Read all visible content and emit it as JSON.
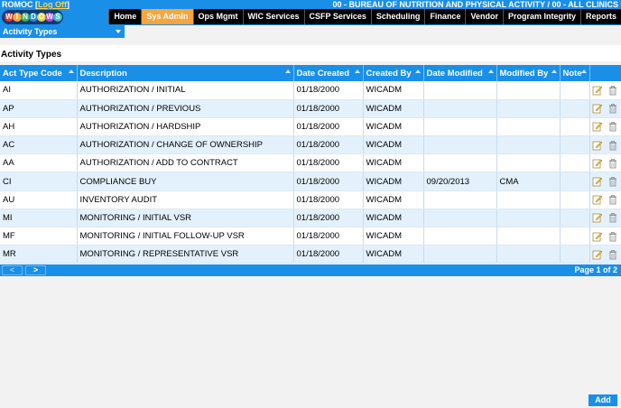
{
  "header": {
    "user": "ROMOC",
    "logoff_label": "Log Off",
    "agency": "00 - BUREAU OF NUTRITION AND PHYSICAL ACTIVITY / 00 - ALL CLINICS",
    "logo_letters": [
      "W",
      "I",
      "N",
      "D",
      "O",
      "W",
      "S"
    ]
  },
  "nav": {
    "items": [
      "Home",
      "Sys Admin",
      "Ops Mgmt",
      "WIC Services",
      "CSFP Services",
      "Scheduling",
      "Finance",
      "Vendor",
      "Program Integrity",
      "Reports"
    ],
    "active": "Sys Admin",
    "accent_color": "#f7a53c"
  },
  "module_select": {
    "value": "Activity Types"
  },
  "page_title": "Activity Types",
  "table": {
    "columns": [
      "Act Type Code",
      "Description",
      "Date Created",
      "Created By",
      "Date Modified",
      "Modified By",
      "Note"
    ],
    "rows": [
      [
        "AI",
        "AUTHORIZATION / INITIAL",
        "01/18/2000",
        "WICADM",
        "",
        "",
        ""
      ],
      [
        "AP",
        "AUTHORIZATION / PREVIOUS",
        "01/18/2000",
        "WICADM",
        "",
        "",
        ""
      ],
      [
        "AH",
        "AUTHORIZATION / HARDSHIP",
        "01/18/2000",
        "WICADM",
        "",
        "",
        ""
      ],
      [
        "AC",
        "AUTHORIZATION / CHANGE OF OWNERSHIP",
        "01/18/2000",
        "WICADM",
        "",
        "",
        ""
      ],
      [
        "AA",
        "AUTHORIZATION / ADD TO CONTRACT",
        "01/18/2000",
        "WICADM",
        "",
        "",
        ""
      ],
      [
        "CI",
        "COMPLIANCE BUY",
        "01/18/2000",
        "WICADM",
        "09/20/2013",
        "CMA",
        ""
      ],
      [
        "AU",
        "INVENTORY AUDIT",
        "01/18/2000",
        "WICADM",
        "",
        "",
        ""
      ],
      [
        "MI",
        "MONITORING / INITIAL VSR",
        "01/18/2000",
        "WICADM",
        "",
        "",
        ""
      ],
      [
        "MF",
        "MONITORING / INITIAL FOLLOW-UP VSR",
        "01/18/2000",
        "WICADM",
        "",
        "",
        ""
      ],
      [
        "MR",
        "MONITORING / REPRESENTATIVE VSR",
        "01/18/2000",
        "WICADM",
        "",
        "",
        ""
      ]
    ],
    "row_icons": [
      "edit-icon",
      "trash-icon"
    ]
  },
  "pager": {
    "prev_label": "<",
    "next_label": ">",
    "page_info": "Page 1 of 2"
  },
  "add_label": "Add",
  "colors": {
    "primary": "#1a8fe8",
    "alt_row": "#e3f1fc"
  }
}
